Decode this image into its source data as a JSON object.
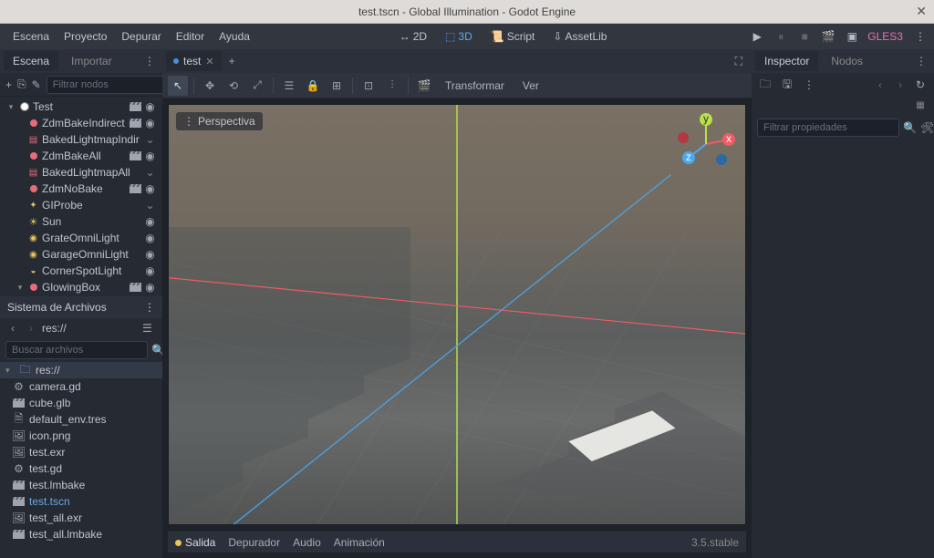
{
  "title": "test.tscn - Global Illumination - Godot Engine",
  "menus": [
    "Escena",
    "Proyecto",
    "Depurar",
    "Editor",
    "Ayuda"
  ],
  "modes": {
    "m2d": "2D",
    "m3d": "3D",
    "script": "Script",
    "assetlib": "AssetLib"
  },
  "renderer": "GLES3",
  "left_tabs": {
    "scene": "Escena",
    "import": "Importar"
  },
  "scene_search_ph": "Filtrar nodos",
  "nodes": [
    {
      "name": "Test",
      "depth": 0,
      "color": "#ffffff",
      "kind": "root",
      "ric": [
        "clap",
        "eye"
      ]
    },
    {
      "name": "ZdmBakeIndirect",
      "depth": 1,
      "color": "#e86b7a",
      "kind": "mesh",
      "ric": [
        "clap",
        "eye"
      ]
    },
    {
      "name": "BakedLightmapIndir",
      "depth": 1,
      "color": "#e86b7a",
      "kind": "bake",
      "ric": [
        "chev"
      ]
    },
    {
      "name": "ZdmBakeAll",
      "depth": 1,
      "color": "#e86b7a",
      "kind": "mesh",
      "ric": [
        "clap",
        "eye"
      ]
    },
    {
      "name": "BakedLightmapAll",
      "depth": 1,
      "color": "#e86b7a",
      "kind": "bake",
      "ric": [
        "chev"
      ]
    },
    {
      "name": "ZdmNoBake",
      "depth": 1,
      "color": "#e86b7a",
      "kind": "mesh",
      "ric": [
        "clap",
        "eye"
      ]
    },
    {
      "name": "GIProbe",
      "depth": 1,
      "color": "#e8c45a",
      "kind": "probe",
      "ric": [
        "chev"
      ]
    },
    {
      "name": "Sun",
      "depth": 1,
      "color": "#e8c45a",
      "kind": "sun",
      "ric": [
        "eye"
      ]
    },
    {
      "name": "GrateOmniLight",
      "depth": 1,
      "color": "#e8c45a",
      "kind": "omni",
      "ric": [
        "eye"
      ]
    },
    {
      "name": "GarageOmniLight",
      "depth": 1,
      "color": "#e8c45a",
      "kind": "omni",
      "ric": [
        "eye"
      ]
    },
    {
      "name": "CornerSpotLight",
      "depth": 1,
      "color": "#e8c45a",
      "kind": "spot",
      "ric": [
        "eye"
      ]
    },
    {
      "name": "GlowingBox",
      "depth": 1,
      "color": "#e86b7a",
      "kind": "mesh",
      "ric": [
        "clap",
        "eye"
      ],
      "exp": true
    }
  ],
  "fs_header": "Sistema de Archivos",
  "fs_path": "res://",
  "fs_search_ph": "Buscar archivos",
  "fs_items": [
    {
      "name": "res://",
      "icon": "folder-open",
      "kind": "folder"
    },
    {
      "name": "camera.gd",
      "icon": "gear"
    },
    {
      "name": "cube.glb",
      "icon": "clap"
    },
    {
      "name": "default_env.tres",
      "icon": "doc"
    },
    {
      "name": "icon.png",
      "icon": "img"
    },
    {
      "name": "test.exr",
      "icon": "img"
    },
    {
      "name": "test.gd",
      "icon": "gear"
    },
    {
      "name": "test.lmbake",
      "icon": "clap"
    },
    {
      "name": "test.tscn",
      "icon": "clap",
      "cls": "tscn"
    },
    {
      "name": "test_all.exr",
      "icon": "img"
    },
    {
      "name": "test_all.lmbake",
      "icon": "clap"
    }
  ],
  "scene_tab": "test",
  "viewport": {
    "persp": "Perspectiva",
    "toolbar_text": {
      "transform": "Transformar",
      "view": "Ver"
    }
  },
  "bottom": {
    "output": "Salida",
    "debugger": "Depurador",
    "audio": "Audio",
    "anim": "Animación",
    "version": "3.5.stable"
  },
  "right_tabs": {
    "inspector": "Inspector",
    "nodes": "Nodos"
  },
  "insp_search_ph": "Filtrar propiedades"
}
